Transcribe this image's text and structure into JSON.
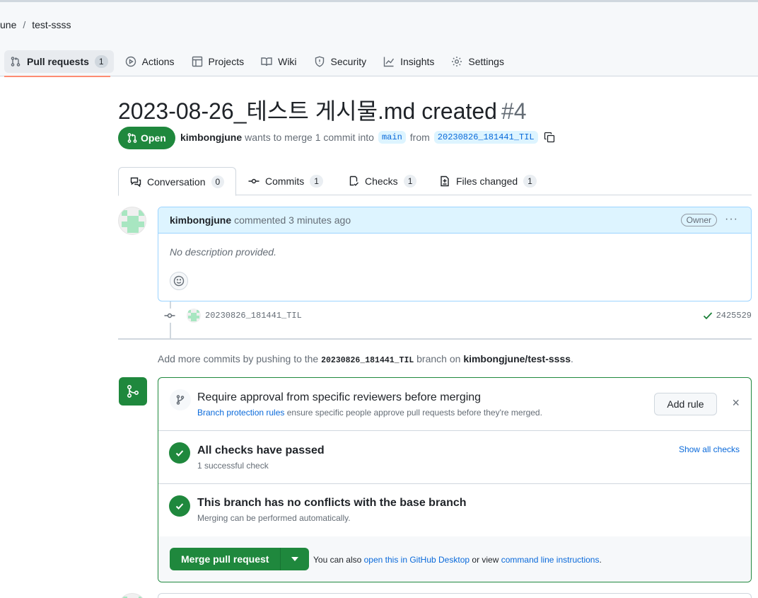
{
  "breadcrumb": {
    "owner": "une",
    "separator": "/",
    "repo": "test-ssss"
  },
  "repo_tabs": [
    {
      "label": "Pull requests",
      "count": "1",
      "icon": "git-pull-request-icon"
    },
    {
      "label": "Actions",
      "icon": "play-icon"
    },
    {
      "label": "Projects",
      "icon": "table-icon"
    },
    {
      "label": "Wiki",
      "icon": "book-icon"
    },
    {
      "label": "Security",
      "icon": "shield-icon"
    },
    {
      "label": "Insights",
      "icon": "graph-icon"
    },
    {
      "label": "Settings",
      "icon": "gear-icon"
    }
  ],
  "pr": {
    "title": "2023-08-26_테스트 게시물.md created",
    "number": "#4",
    "state": "Open",
    "author": "kimbongjune",
    "merge_text": "wants to merge 1 commit into",
    "base_branch": "main",
    "from_text": "from",
    "head_branch": "20230826_181441_TIL"
  },
  "pr_tabs": [
    {
      "label": "Conversation",
      "count": "0"
    },
    {
      "label": "Commits",
      "count": "1"
    },
    {
      "label": "Checks",
      "count": "1"
    },
    {
      "label": "Files changed",
      "count": "1"
    }
  ],
  "comment": {
    "author": "kimbongjune",
    "action": "commented 3 minutes ago",
    "role": "Owner",
    "menu": "···",
    "body": "No description provided."
  },
  "commit": {
    "message": "20230826_181441_TIL",
    "sha": "2425529"
  },
  "push_note": {
    "prefix": "Add more commits by pushing to the",
    "branch": "20230826_181441_TIL",
    "middle": "branch on",
    "repo": "kimbongjune/test-ssss",
    "suffix": "."
  },
  "mergebox": {
    "rule_title": "Require approval from specific reviewers before merging",
    "rule_link": "Branch protection rules",
    "rule_sub": "ensure specific people approve pull requests before they're merged.",
    "add_rule": "Add rule",
    "close": "×",
    "checks_title": "All checks have passed",
    "checks_sub": "1 successful check",
    "show_checks": "Show all checks",
    "conflict_title": "This branch has no conflicts with the base branch",
    "conflict_sub": "Merging can be performed automatically.",
    "merge_button": "Merge pull request",
    "footer_prefix": "You can also",
    "footer_link1": "open this in GitHub Desktop",
    "footer_middle": "or view",
    "footer_link2": "command line instructions",
    "footer_suffix": "."
  },
  "colors": {
    "green": "#1f883d",
    "accent": "#0969da",
    "underline": "#fd8c73",
    "avatar": "#a8e6c1"
  }
}
